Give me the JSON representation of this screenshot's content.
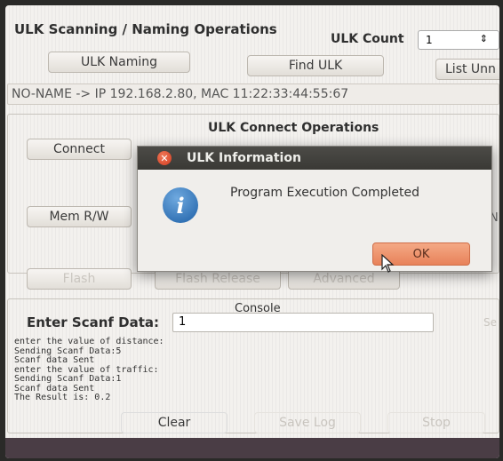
{
  "scanning": {
    "title": "ULK Scanning / Naming Operations",
    "count_label": "ULK Count",
    "count_value": "1",
    "buttons": {
      "naming": "ULK Naming",
      "find": "Find ULK",
      "list": "List Unn"
    },
    "device_line": "NO-NAME -> IP 192.168.2.80, MAC 11:22:33:44:55:67"
  },
  "connect": {
    "title": "ULK Connect Operations",
    "connect_button": "Connect",
    "mem_button": "Mem R/W",
    "right_edge_fragment": "N"
  },
  "flash": {
    "flash": "Flash",
    "flash_release": "Flash Release",
    "advanced": "Advanced"
  },
  "console": {
    "title": "Console",
    "scanf_label": "Enter Scanf Data:",
    "scanf_value": "1",
    "send_fragment": "Se",
    "lines": [
      "enter the value of distance:",
      "Sending Scanf Data:5",
      "Scanf data Sent",
      "enter the value of traffic:",
      "Sending Scanf Data:1",
      "Scanf data Sent",
      "The Result is: 0.2"
    ],
    "clear": "Clear",
    "save_log": "Save Log",
    "stop": "Stop"
  },
  "dialog": {
    "title": "ULK Information",
    "message": "Program Execution Completed",
    "ok": "OK"
  },
  "icons": {
    "close": "close-icon",
    "info": "info-icon",
    "cursor": "mouse-pointer-icon",
    "spin": "chevron-up-down-icon"
  },
  "colors": {
    "dialog_title_bg": "#3f3e3a",
    "ok_button": "#ec8d65",
    "close_button": "#e0502f",
    "info_icon": "#2c6fb3"
  }
}
